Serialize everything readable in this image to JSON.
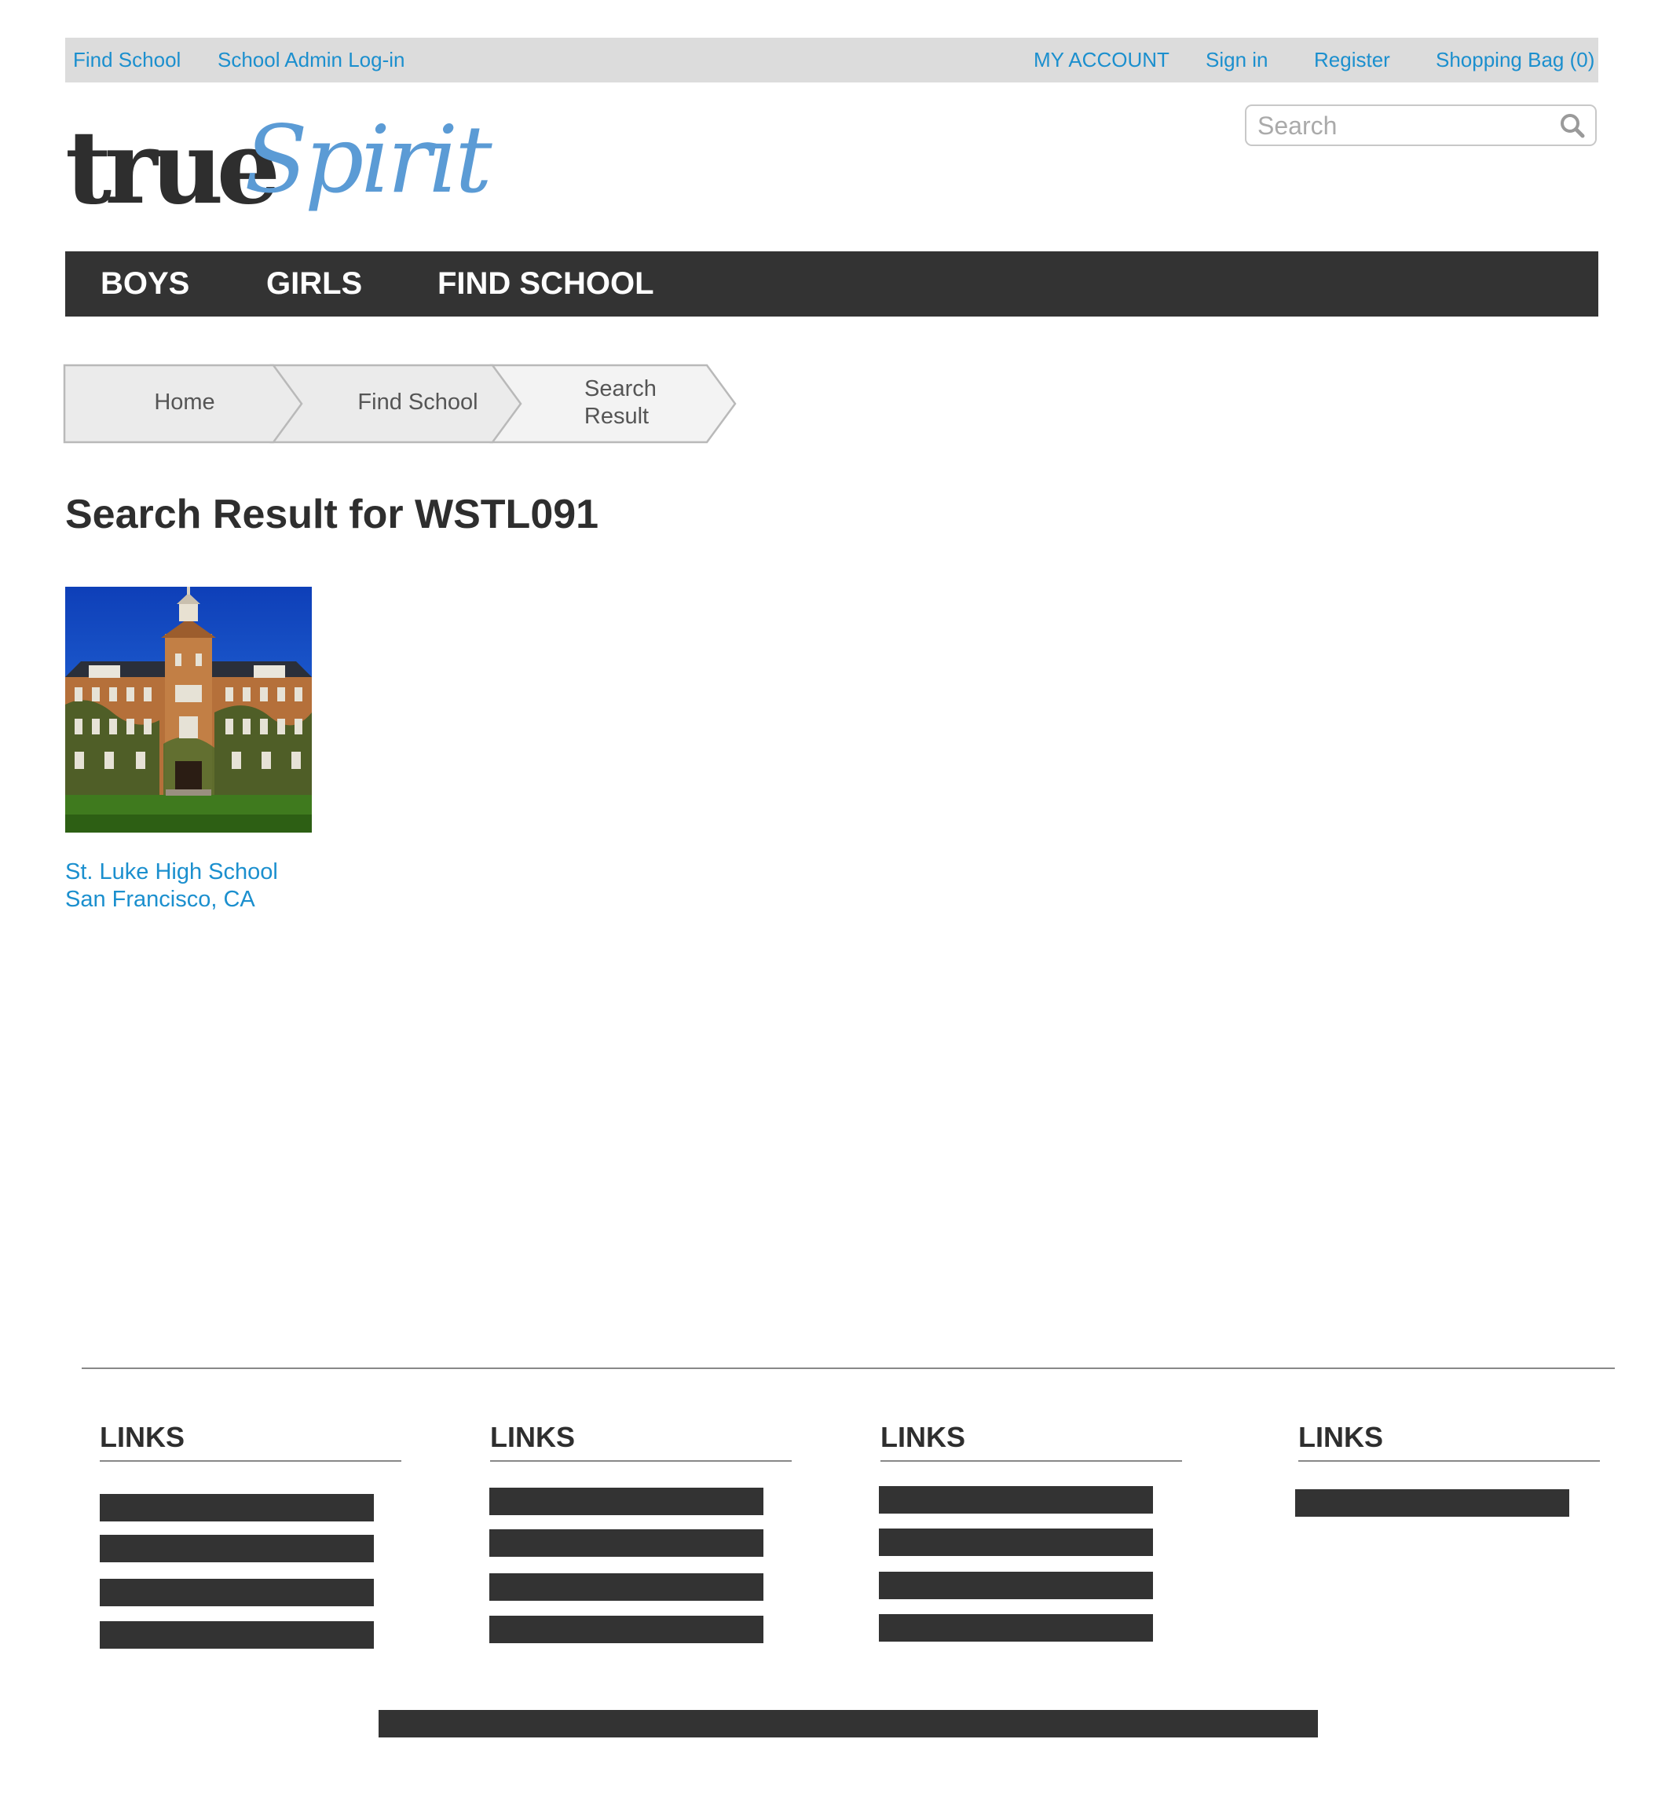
{
  "topbar": {
    "find_school": "Find School",
    "school_admin_login": "School Admin Log-in",
    "my_account": "MY ACCOUNT",
    "sign_in": "Sign in",
    "register": "Register",
    "shopping_bag": "Shopping Bag (0)"
  },
  "logo": {
    "part1": "true",
    "part2": "Spirit"
  },
  "search": {
    "placeholder": "Search",
    "value": ""
  },
  "nav": {
    "items": [
      "BOYS",
      "GIRLS",
      "FIND SCHOOL"
    ]
  },
  "breadcrumb": {
    "items": [
      {
        "line1": "Home",
        "line2": ""
      },
      {
        "line1": "Find School",
        "line2": ""
      },
      {
        "line1": "Search",
        "line2": "Result"
      }
    ]
  },
  "page": {
    "title": "Search Result for WSTL091"
  },
  "result": {
    "name": "St. Luke High School",
    "location": "San Francisco, CA"
  },
  "footer": {
    "column_headings": [
      "LINKS",
      "LINKS",
      "LINKS",
      "LINKS"
    ]
  },
  "colors": {
    "link": "#1b8fce",
    "nav_bg": "#333333",
    "topbar_bg": "#dcdcdc",
    "logo_accent": "#5b9bd5",
    "text_dark": "#2e2e2e"
  }
}
